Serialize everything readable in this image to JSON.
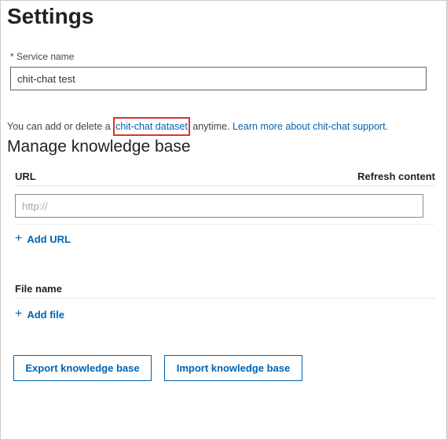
{
  "page": {
    "title": "Settings",
    "manage_heading": "Manage knowledge base"
  },
  "service": {
    "label": "* Service name",
    "value": "chit-chat test"
  },
  "desc": {
    "prefix": "You can add or delete a ",
    "highlight_link": "chit-chat dataset",
    "mid": " anytime. ",
    "learn_link": "Learn more about chit-chat support."
  },
  "kb": {
    "url_header": "URL",
    "refresh_header": "Refresh content",
    "url_placeholder": "http://",
    "add_url_label": "Add URL",
    "file_header": "File name",
    "add_file_label": "Add file"
  },
  "buttons": {
    "export": "Export knowledge base",
    "import": "Import knowledge base"
  },
  "icons": {
    "plus": "+"
  }
}
